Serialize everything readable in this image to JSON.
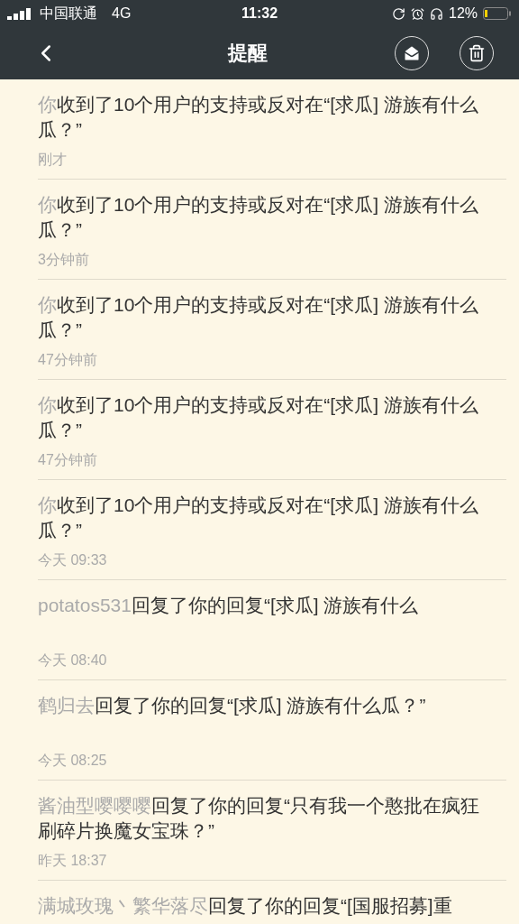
{
  "status_bar": {
    "carrier": "中国联通",
    "network": "4G",
    "time": "11:32",
    "battery": "12%"
  },
  "header": {
    "title": "提醒"
  },
  "notifications": [
    {
      "actor": "你",
      "text": "收到了10个用户的支持或反对在“[求瓜] 游族有什么瓜？”",
      "time": "刚才"
    },
    {
      "actor": "你",
      "text": "收到了10个用户的支持或反对在“[求瓜] 游族有什么瓜？”",
      "time": "3分钟前"
    },
    {
      "actor": "你",
      "text": "收到了10个用户的支持或反对在“[求瓜] 游族有什么瓜？”",
      "time": "47分钟前"
    },
    {
      "actor": "你",
      "text": "收到了10个用户的支持或反对在“[求瓜] 游族有什么瓜？”",
      "time": "47分钟前"
    },
    {
      "actor": "你",
      "text": "收到了10个用户的支持或反对在“[求瓜] 游族有什么瓜？”",
      "time": "今天 09:33"
    },
    {
      "actor": "potatos531",
      "text": "回复了你的回复“[求瓜] 游族有什么",
      "time": "今天 08:40"
    },
    {
      "actor": "鹤归去",
      "text": "回复了你的回复“[求瓜] 游族有什么瓜？”",
      "time": "今天 08:25"
    },
    {
      "actor": "酱油型嘤嘤嘤",
      "text": "回复了你的回复“只有我一个憨批在疯狂刷碎片换魔女宝珠？”",
      "time": "昨天 18:37"
    },
    {
      "actor": "满城玫瑰丶繁华落尽",
      "text": "回复了你的回复“[国服招募]重"
    }
  ]
}
